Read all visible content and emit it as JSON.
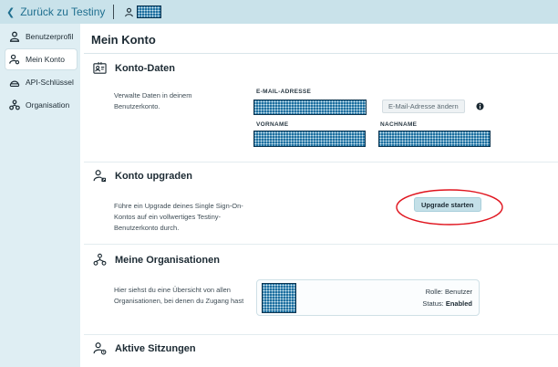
{
  "topbar": {
    "back_label": "Zurück zu Testiny",
    "back_icon": "chevron-left-icon",
    "user_icon": "user-icon"
  },
  "sidebar": {
    "items": [
      {
        "label": "Benutzerprofil",
        "icon": "user-icon",
        "active": false
      },
      {
        "label": "Mein Konto",
        "icon": "user-settings-icon",
        "active": true
      },
      {
        "label": "API-Schlüssel",
        "icon": "key-icon",
        "active": false
      },
      {
        "label": "Organisation",
        "icon": "organization-icon",
        "active": false
      }
    ]
  },
  "main": {
    "title": "Mein Konto",
    "account_data": {
      "heading": "Konto-Daten",
      "description": "Verwalte Daten in deinem Benutzerkonto.",
      "email_label": "E-MAIL-ADRESSE",
      "change_email_label": "E-Mail-Adresse ändern",
      "firstname_label": "VORNAME",
      "lastname_label": "NACHNAME"
    },
    "upgrade": {
      "heading": "Konto upgraden",
      "description": "Führe ein Upgrade deines Single Sign-On-Kontos auf ein vollwertiges Testiny-Benutzerkonto durch.",
      "button_label": "Upgrade starten"
    },
    "organizations": {
      "heading": "Meine Organisationen",
      "description": "Hier siehst du eine Übersicht von allen Organisationen, bei denen du Zugang hast",
      "role_label": "Rolle:",
      "role_value": "Benutzer",
      "status_label": "Status:",
      "status_value": "Enabled"
    },
    "sessions": {
      "heading": "Aktive Sitzungen"
    }
  },
  "colors": {
    "topbar_bg": "#c9e2ea",
    "sidebar_bg": "#dfeef3",
    "accent_link": "#1f6f8f",
    "annotation_red": "#e0141e",
    "redaction": "#1d6fa0"
  }
}
